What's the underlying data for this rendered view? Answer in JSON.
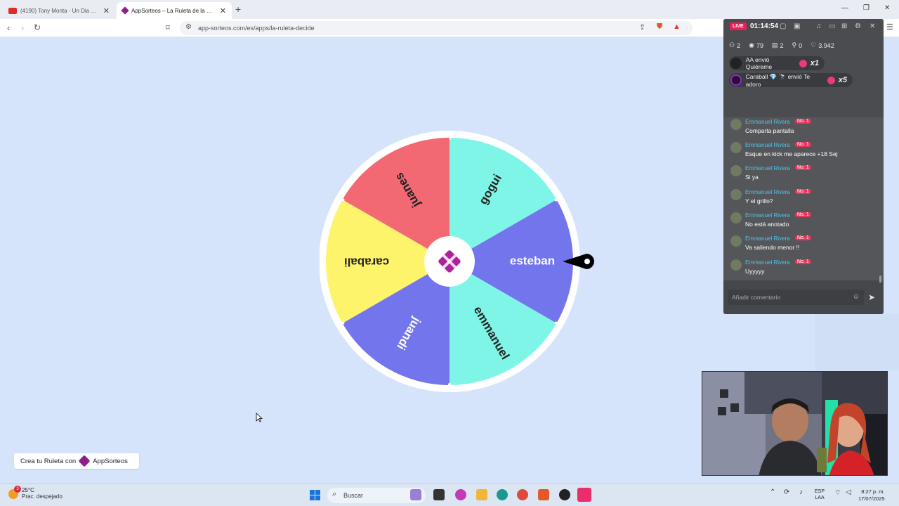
{
  "browser": {
    "tabs": [
      {
        "title": "(4190) Tony Monta - Un Dia En Mi Br",
        "active": false
      },
      {
        "title": "AppSorteos – La Ruleta de la Suerte",
        "active": true
      }
    ],
    "url": "app-sorteos.com/es/apps/la-ruleta-decide",
    "new_tab": "+",
    "minimize": "—",
    "maximize": "❐",
    "close": "✕"
  },
  "wheel": {
    "segments": [
      {
        "label": "gogui",
        "color": "#7ef5e6",
        "text_color": "#222222"
      },
      {
        "label": "esteban",
        "color": "#7375ec",
        "text_color": "#ffffff"
      },
      {
        "label": "emmanuel",
        "color": "#7ef5e6",
        "text_color": "#222222"
      },
      {
        "label": "juandi",
        "color": "#7375ec",
        "text_color": "#ffffff"
      },
      {
        "label": "carabali",
        "color": "#fdf46c",
        "text_color": "#222222"
      },
      {
        "label": "juanes",
        "color": "#f26873",
        "text_color": "#222222"
      }
    ],
    "center_logo_color": "#b0209a"
  },
  "footer": {
    "create_label": "Crea tu Ruleta con",
    "brand": "AppSorteos"
  },
  "live": {
    "badge": "LIVE",
    "time": "01:14:54",
    "stats": {
      "users": "2",
      "views": "79",
      "gifts": "2",
      "shares": "0",
      "likes": "3.942"
    },
    "gifts": [
      {
        "text": "AA envió Quiéreme",
        "mult": "x1"
      },
      {
        "text": "Caraball 💎 🔭 envió Te adoro",
        "mult": "x5"
      }
    ],
    "chat": [
      {
        "name": "Emmanuel Rivera",
        "badge": "No. 1",
        "text": "Comparta pantalla"
      },
      {
        "name": "Emmanuel Rivera",
        "badge": "No. 1",
        "text": "Esque en kick me aparece +18 Sej"
      },
      {
        "name": "Emmanuel Rivera",
        "badge": "No. 1",
        "text": "Si ya"
      },
      {
        "name": "Emmanuel Rivera",
        "badge": "No. 1",
        "text": "Y el grillo?"
      },
      {
        "name": "Emmanuel Rivera",
        "badge": "No. 1",
        "text": "No está anotado"
      },
      {
        "name": "Emmanuel Rivera",
        "badge": "No. 1",
        "text": "Va saliendo menor !!"
      },
      {
        "name": "Emmanuel Rivera",
        "badge": "No. 1",
        "text": "Uyyyyy"
      }
    ],
    "comment_placeholder": "Añadir comentario"
  },
  "taskbar": {
    "weather_temp": "25°C",
    "weather_desc": "Prac. despejado",
    "weather_badge": "3",
    "search_label": "Buscar",
    "lang_top": "ESP",
    "lang_bottom": "LAA",
    "time": "8:27 p. m.",
    "date": "17/07/2025"
  }
}
